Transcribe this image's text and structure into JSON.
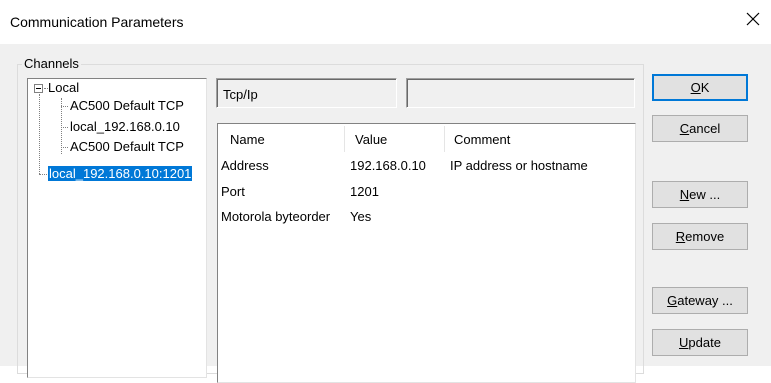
{
  "window": {
    "title": "Communication Parameters",
    "close_icon": "close-icon"
  },
  "channels": {
    "group_label": "Channels",
    "tree": {
      "root": "Local",
      "children": [
        "AC500 Default TCP",
        "local_192.168.0.10",
        "AC500 Default TCP"
      ],
      "selected": "local_192.168.0.10:1201"
    }
  },
  "fields": {
    "protocol": "Tcp/Ip",
    "second": ""
  },
  "params": {
    "columns": [
      "Name",
      "Value",
      "Comment"
    ],
    "rows": [
      {
        "name": "Address",
        "value": "192.168.0.10",
        "comment": "IP address or hostname"
      },
      {
        "name": "Port",
        "value": "1201",
        "comment": ""
      },
      {
        "name": "Motorola byteorder",
        "value": "Yes",
        "comment": ""
      }
    ]
  },
  "buttons": {
    "ok": {
      "mnemonic": "O",
      "rest": "K"
    },
    "cancel": {
      "mnemonic": "C",
      "rest": "ancel"
    },
    "new": {
      "mnemonic": "N",
      "rest": "ew ..."
    },
    "remove": {
      "mnemonic": "R",
      "rest": "emove"
    },
    "gateway": {
      "mnemonic": "G",
      "rest": "ateway ..."
    },
    "update": {
      "mnemonic": "U",
      "rest": "pdate"
    }
  }
}
